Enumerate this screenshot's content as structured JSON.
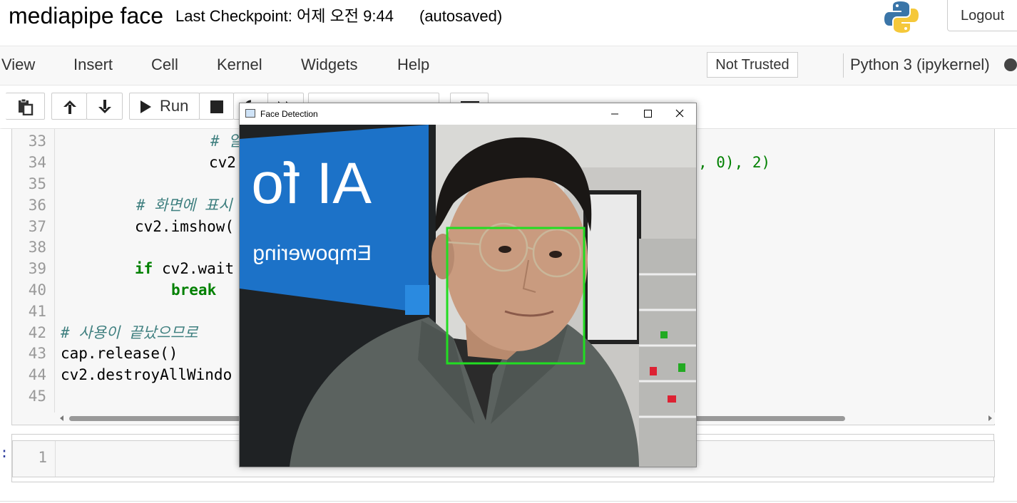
{
  "header": {
    "notebook_title": "mediapipe face",
    "checkpoint": "Last Checkpoint: 어제 오전 9:44",
    "autosave": "(autosaved)",
    "logout_label": "Logout",
    "logo_icon": "python-logo-icon"
  },
  "menubar": {
    "items": [
      "View",
      "Insert",
      "Cell",
      "Kernel",
      "Widgets",
      "Help"
    ],
    "trust_label": "Not Trusted",
    "kernel_name": "Python 3 (ipykernel)"
  },
  "toolbar": {
    "run_label": "Run",
    "icons": [
      "paste-icon",
      "move-up-icon",
      "move-down-icon",
      "run-icon",
      "stop-icon",
      "restart-icon",
      "fast-forward-icon",
      "cell-type-select",
      "keyboard-icon"
    ]
  },
  "code_cell": {
    "line_numbers": [
      "33",
      "34",
      "35",
      "36",
      "37",
      "38",
      "39",
      "40",
      "41",
      "42",
      "43",
      "44",
      "45"
    ],
    "lines": {
      "l33": "# 얼",
      "l34a": "cv2",
      "l34b": ", 0), 2)",
      "l36": "# 화면에 표시",
      "l37": "cv2.imshow(",
      "l39_kw": "if",
      "l39": " cv2.wait",
      "l40": "break",
      "l42": "# 사용이 끝났으므로",
      "l43": "cap.release()",
      "l44": "cv2.destroyAllWindo"
    }
  },
  "empty_cell": {
    "line_number": "1",
    "prompt": ":"
  },
  "face_window": {
    "title": "Face Detection",
    "sign_text": "AI fo",
    "sign_subtext": "Empowering",
    "detection_color": "#22dd22"
  },
  "colors": {
    "comment": "#408080",
    "keyword": "#008000",
    "sign_blue": "#1c72c8"
  }
}
